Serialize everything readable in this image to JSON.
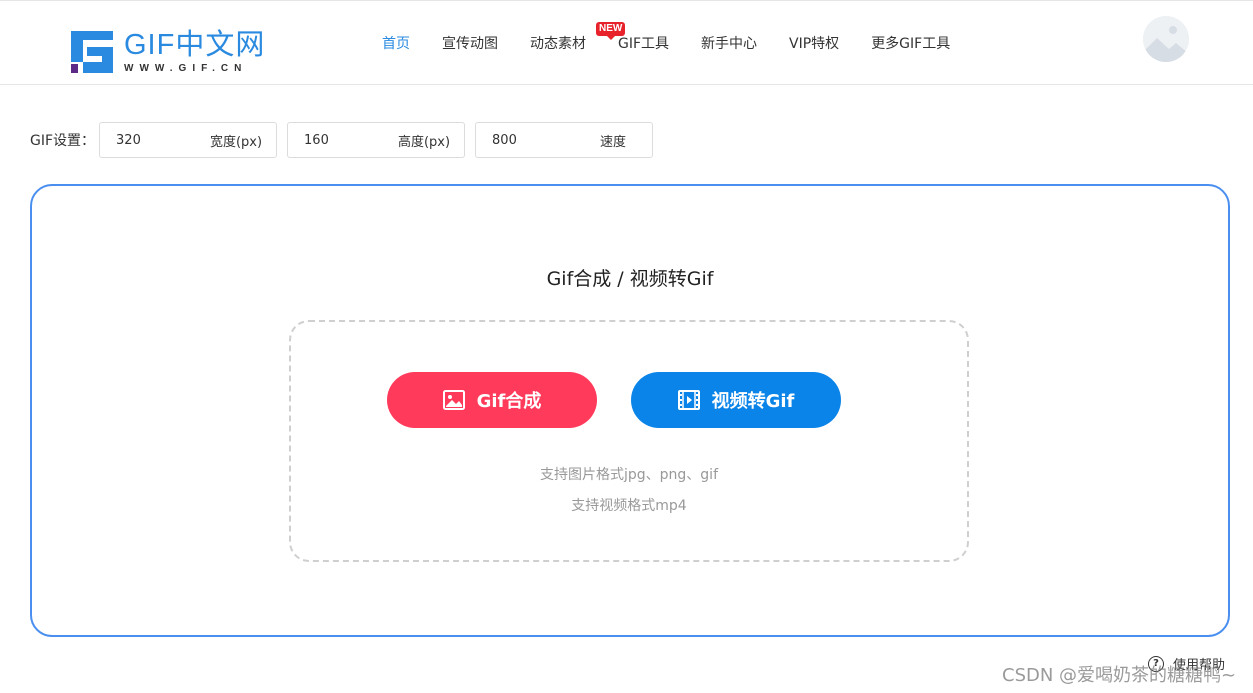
{
  "brand": {
    "name": "GIF中文网",
    "url_text": "WWW.GIF.CN"
  },
  "nav": {
    "items": [
      {
        "label": "首页"
      },
      {
        "label": "宣传动图"
      },
      {
        "label": "动态素材"
      },
      {
        "label": "GIF工具"
      },
      {
        "label": "新手中心"
      },
      {
        "label": "VIP特权"
      },
      {
        "label": "更多GIF工具"
      }
    ],
    "new_badge": "NEW"
  },
  "settings": {
    "label": "GIF设置：",
    "width": {
      "value": "320",
      "unit": "宽度(px)"
    },
    "height": {
      "value": "160",
      "unit": "高度(px)"
    },
    "speed": {
      "value": "800",
      "unit": "速度"
    }
  },
  "panel": {
    "title": "Gif合成 / 视频转Gif",
    "gif_button": "Gif合成",
    "video_button": "视频转Gif",
    "hint_image": "支持图片格式jpg、png、gif",
    "hint_video": "支持视频格式mp4"
  },
  "help": {
    "label": "使用帮助",
    "icon_glyph": "?"
  },
  "watermark": "CSDN @爱喝奶茶的糖糖鸭~",
  "colors": {
    "accent": "#2a8ae0",
    "gif_button": "#ff3a5a",
    "video_button": "#0a84e8",
    "panel_border": "#4a8ff0",
    "new_badge": "#e8222a"
  }
}
